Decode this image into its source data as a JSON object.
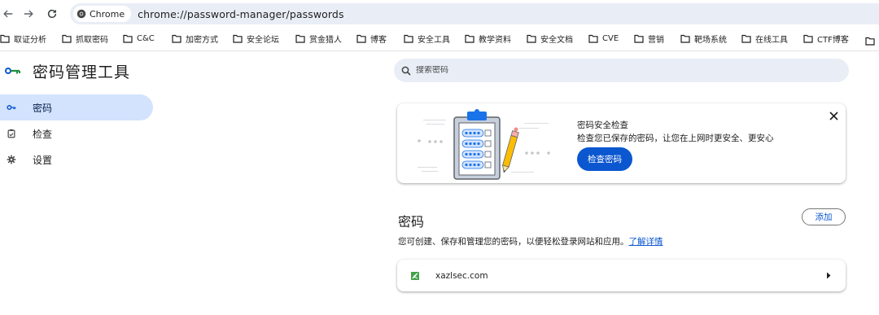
{
  "browser": {
    "site_chip_label": "Chrome",
    "url": "chrome://password-manager/passwords",
    "bookmarks": [
      {
        "label": "取证分析"
      },
      {
        "label": "抓取密码"
      },
      {
        "label": "C&C"
      },
      {
        "label": "加密方式"
      },
      {
        "label": "安全论坛"
      },
      {
        "label": "赏金猎人"
      },
      {
        "label": "博客"
      },
      {
        "label": "安全工具"
      },
      {
        "label": "教学资料"
      },
      {
        "label": "安全文档"
      },
      {
        "label": "CVE"
      },
      {
        "label": "营销"
      },
      {
        "label": "靶场系统"
      },
      {
        "label": "在线工具"
      },
      {
        "label": "CTF博客"
      }
    ]
  },
  "app": {
    "title": "密码管理工具"
  },
  "sidebar": {
    "items": [
      {
        "label": "密码",
        "icon": "key-icon",
        "active": true
      },
      {
        "label": "检查",
        "icon": "checkup-icon",
        "active": false
      },
      {
        "label": "设置",
        "icon": "gear-icon",
        "active": false
      }
    ]
  },
  "search": {
    "placeholder": "搜索密码"
  },
  "checkup_card": {
    "title": "密码安全检查",
    "description": "检查您已保存的密码，让您在上网时更安全、更安心",
    "button_label": "检查密码"
  },
  "passwords": {
    "heading": "密码",
    "add_label": "添加",
    "description": "您可创建、保存和管理您的密码，以便轻松登录网站和应用。",
    "learn_more": "了解详情",
    "entries": [
      {
        "site": "xazlsec.com",
        "icon": "site-favicon"
      }
    ]
  },
  "colors": {
    "accent": "#0b57d0",
    "active_nav_bg": "#d3e3fd",
    "omnibox_bg": "#e9eef6"
  }
}
